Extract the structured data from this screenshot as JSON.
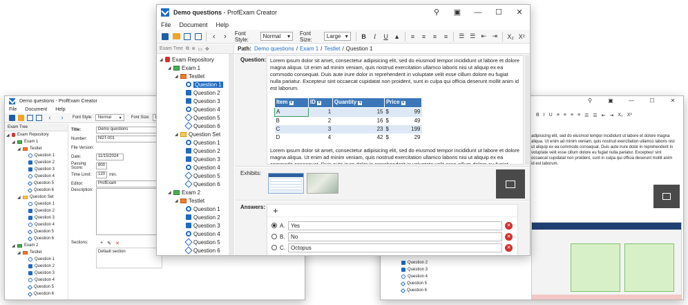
{
  "app": {
    "title_bold": "Demo questions",
    "title_rest": " - ProfExam Creator"
  },
  "menu": [
    "File",
    "Document",
    "Help"
  ],
  "toolbar": {
    "font_style_label": "Font Style:",
    "font_style_value": "Normal",
    "font_size_label": "Font Size:",
    "font_size_value": "Large"
  },
  "left_win": {
    "exam_tree_tab": "Exam Tree",
    "fields": {
      "title_label": "Title:",
      "title_value": "Demo questions",
      "number_label": "Number:",
      "number_value": "NDT-001",
      "file_version_label": "File Version:",
      "date_label": "Date:",
      "date_value": "11/15/2024",
      "passing_label": "Passing Score:",
      "passing_value": "800",
      "time_label": "Time Limit:",
      "time_value": "120",
      "time_unit": "min.",
      "editor_label": "Editor:",
      "editor_value": "ProfExam",
      "description_label": "Description:",
      "sections_label": "Sections:",
      "sections_item": "Default section"
    }
  },
  "tree": {
    "root": "Exam Repository",
    "exam1": "Exam 1",
    "testlet": "Testlet",
    "question_set": "Question Set",
    "exam2": "Exam 2",
    "q1": "Question 1",
    "q2": "Question 2",
    "q3": "Question 3",
    "q4": "Question 4",
    "q5": "Question 5",
    "q6": "Question 6"
  },
  "main": {
    "path_label": "Path:",
    "path_parts": [
      "Demo questions",
      "Exam 1",
      "Testlet",
      "Question 1"
    ],
    "question_label": "Question:",
    "question_text_1": "Lorem ipsum dolor sit amet, consectetur adipisicing elit, sed do eiusmod tempor incididunt ut labore et dolore magna aliqua. Ut enim ad minim veniam, quis nostrud exercitation ullamco laboris nisi ut aliquip ex ea commodo consequat. Duis aute irure dolor in reprehenderit in voluptate velit esse cillum dolore eu fugiat nulla pariatur. Excepteur sint occaecat cupidatat non proident, sunt in culpa qui officia deserunt mollit anim id est laborum.",
    "question_text_2": "Lorem ipsum dolor sit amet, consectetur adipisicing elit, sed do eiusmod tempor incididunt ut labore et dolore magna aliqua. Ut enim ad minim veniam, quis nostrud exercitation ullamco laboris nisi ut aliquip ex ea commodo consequat. Duis aute irure dolor in reprehenderit in voluptate velit esse cillum dolore eu fugiat nulla pariatur. Excepteur sint occaecat cupidatat non proident, sunt in culpa qui officia deserunt mollit anim id est laborum.",
    "table": {
      "headers": [
        "Item",
        "ID",
        "Quantity",
        "Price"
      ],
      "rows": [
        [
          "A",
          "1",
          "15",
          "$",
          "99"
        ],
        [
          "B",
          "2",
          "16",
          "$",
          "49"
        ],
        [
          "C",
          "3",
          "23",
          "$",
          "199"
        ],
        [
          "D",
          "4",
          "42",
          "$",
          "29"
        ]
      ]
    },
    "exhibits_label": "Exhibits:",
    "answers_label": "Answers:",
    "answers": [
      {
        "letter": "A.",
        "text": "Yes"
      },
      {
        "letter": "B.",
        "text": "No"
      },
      {
        "letter": "C.",
        "text": "Octopus"
      }
    ]
  },
  "right_win": {
    "text": "adipisicing elit, sed do eiusmod tempor incididunt ut labore et dolore magna aliqua. Ut enim ad minim veniam, quis nostrud exercitation ullamco laboris nisi ut aliquip ex ea commodo consequat. Duis aute irure dolor in reprehenderit in voluptate velit esse cillum dolore eu fugiat nulla pariatur. Excepteur sint occaecat cupidatat non proident, sunt in culpa qui officia deserunt mollit anim id est laborum.",
    "tree_q": [
      "Question 2",
      "Question 3",
      "Question 4",
      "Question 5",
      "Question 6"
    ]
  }
}
